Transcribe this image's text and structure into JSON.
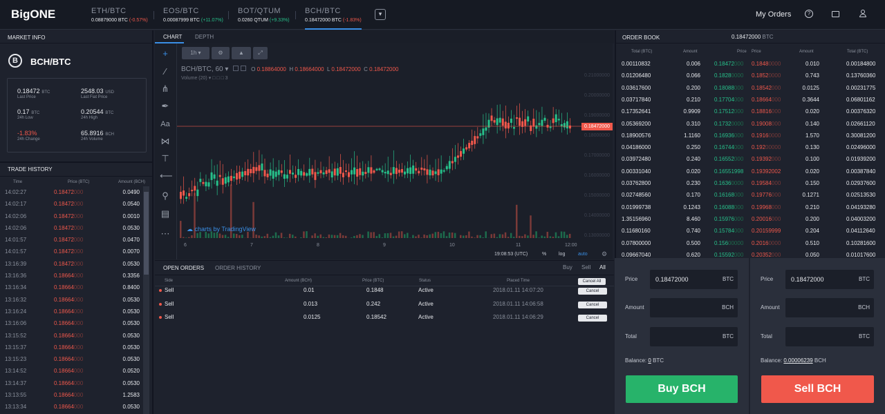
{
  "colors": {
    "bg": "#1e222d",
    "up": "#27c08a",
    "down": "#f0584b",
    "accent": "#3a8fe6"
  },
  "header": {
    "logo": "BigONE",
    "my_orders": "My Orders",
    "markets": [
      {
        "name": "ETH/BTC",
        "price": "0.08879000 BTC",
        "chg": "(-0.57%)",
        "dir": "dn"
      },
      {
        "name": "EOS/BTC",
        "price": "0.00087999 BTC",
        "chg": "(+11.07%)",
        "dir": "up"
      },
      {
        "name": "BOT/QTUM",
        "price": "0.0260 QTUM",
        "chg": "(+9.33%)",
        "dir": "up"
      },
      {
        "name": "BCH/BTC",
        "price": "0.18472000 BTC",
        "chg": "(-1.83%)",
        "dir": "dn"
      }
    ]
  },
  "market_info": {
    "title": "MARKET INFO",
    "pair": "BCH/BTC",
    "last_price": "0.18472",
    "last_price_unit": "BTC",
    "last_price_label": "Last Price",
    "last_fiat": "2548.03",
    "last_fiat_unit": "USD",
    "last_fiat_label": "Last Fiat Price",
    "low": "0.17",
    "low_unit": "BTC",
    "low_label": "24h Low",
    "high": "0.20544",
    "high_unit": "BTC",
    "high_label": "24h High",
    "change": "-1.83%",
    "change_label": "24h Change",
    "volume": "65.8916",
    "volume_unit": "BCH",
    "volume_label": "24h Volume"
  },
  "trade_history": {
    "title": "TRADE HISTORY",
    "col_time": "Time",
    "col_price": "Price (BTC)",
    "col_amount": "Amount (BCH)",
    "rows": [
      [
        "14:02:27",
        "0.18472000",
        "0.0490",
        "dn"
      ],
      [
        "14:02:17",
        "0.18472000",
        "0.0540",
        "dn"
      ],
      [
        "14:02:06",
        "0.18472000",
        "0.0010",
        "dn"
      ],
      [
        "14:02:06",
        "0.18472000",
        "0.0530",
        "dn"
      ],
      [
        "14:01:57",
        "0.18472000",
        "0.0470",
        "dn"
      ],
      [
        "14:01:57",
        "0.18472000",
        "0.0070",
        "dn"
      ],
      [
        "13:16:39",
        "0.18472000",
        "0.0530",
        "dn"
      ],
      [
        "13:16:36",
        "0.18664000",
        "0.3356",
        "dn"
      ],
      [
        "13:16:34",
        "0.18664000",
        "0.8400",
        "dn"
      ],
      [
        "13:16:32",
        "0.18664000",
        "0.0530",
        "dn"
      ],
      [
        "13:16:24",
        "0.18664000",
        "0.0530",
        "dn"
      ],
      [
        "13:16:06",
        "0.18664000",
        "0.0530",
        "dn"
      ],
      [
        "13:15:52",
        "0.18664000",
        "0.0530",
        "dn"
      ],
      [
        "13:15:37",
        "0.18664000",
        "0.0530",
        "dn"
      ],
      [
        "13:15:23",
        "0.18664000",
        "0.0530",
        "dn"
      ],
      [
        "13:14:52",
        "0.18664000",
        "0.0520",
        "dn"
      ],
      [
        "13:14:37",
        "0.18664000",
        "0.0530",
        "dn"
      ],
      [
        "13:13:55",
        "0.18664000",
        "1.2583",
        "dn"
      ],
      [
        "13:13:34",
        "0.18664000",
        "0.0530",
        "dn"
      ]
    ]
  },
  "chart": {
    "tab_chart": "CHART",
    "tab_depth": "DEPTH",
    "interval": "1h",
    "symbol": "BCH/BTC, 60",
    "o": "0.18864000",
    "h": "0.18664000",
    "l": "0.18472000",
    "c": "0.18472000",
    "volume_label": "Volume (20)",
    "volume_val": "3",
    "last_tag": "0.18472000",
    "brand": "charts by TradingView",
    "time": "19:08:53 (UTC)",
    "pct": "%",
    "log": "log",
    "auto": "auto",
    "y_ticks": [
      "0.21000000",
      "0.20000000",
      "0.19000000",
      "0.18000000",
      "0.17000000",
      "0.16000000",
      "0.15000000",
      "0.14000000",
      "0.13000000"
    ],
    "x_ticks": [
      "6",
      "7",
      "8",
      "9",
      "10",
      "11",
      "12:00"
    ]
  },
  "orders": {
    "tab_open": "OPEN ORDERS",
    "tab_history": "ORDER HISTORY",
    "f_buy": "Buy",
    "f_sell": "Sell",
    "f_all": "All",
    "col_side": "Side",
    "col_amount": "Amount (BCH)",
    "col_price": "Price (BTC)",
    "col_status": "Status",
    "col_placed": "Placed Time",
    "cancel_all": "Cancel All",
    "cancel": "Cancel",
    "rows": [
      {
        "side": "Sell",
        "amount": "0.01",
        "price": "0.1848",
        "status": "Active",
        "time": "2018.01.11 14:07:20"
      },
      {
        "side": "Sell",
        "amount": "0.013",
        "price": "0.242",
        "status": "Active",
        "time": "2018.01.11 14:06:58"
      },
      {
        "side": "Sell",
        "amount": "0.0125",
        "price": "0.18542",
        "status": "Active",
        "time": "2018.01.11 14:06:29"
      }
    ]
  },
  "order_book": {
    "title": "ORDER BOOK",
    "mid": "0.18472000",
    "mid_unit": "BTC",
    "col_total": "Total (BTC)",
    "col_amount": "Amount",
    "col_price": "Price",
    "rows": [
      [
        "0.00110832",
        "0.006",
        "0.18472000",
        "0.18480000",
        "0.010",
        "0.00184800"
      ],
      [
        "0.01206480",
        "0.066",
        "0.18280000",
        "0.18520000",
        "0.743",
        "0.13760360"
      ],
      [
        "0.03617600",
        "0.200",
        "0.18088000",
        "0.18542000",
        "0.0125",
        "0.00231775"
      ],
      [
        "0.03717840",
        "0.210",
        "0.17704000",
        "0.18664000",
        "0.3644",
        "0.06801162"
      ],
      [
        "0.17352641",
        "0.9909",
        "0.17512000",
        "0.18816000",
        "0.020",
        "0.00376320"
      ],
      [
        "0.05369200",
        "0.310",
        "0.17320000",
        "0.19008000",
        "0.140",
        "0.02661120"
      ],
      [
        "0.18900576",
        "1.1160",
        "0.16936000",
        "0.19160000",
        "1.570",
        "0.30081200"
      ],
      [
        "0.04186000",
        "0.250",
        "0.16744000",
        "0.19200000",
        "0.130",
        "0.02496000"
      ],
      [
        "0.03972480",
        "0.240",
        "0.16552000",
        "0.19392000",
        "0.100",
        "0.01939200"
      ],
      [
        "0.00331040",
        "0.020",
        "0.16551998",
        "0.19392002",
        "0.020",
        "0.00387840"
      ],
      [
        "0.03762800",
        "0.230",
        "0.16360000",
        "0.19584000",
        "0.150",
        "0.02937600"
      ],
      [
        "0.02748560",
        "0.170",
        "0.16168000",
        "0.19776000",
        "0.1271",
        "0.02513530"
      ],
      [
        "0.01999738",
        "0.1243",
        "0.16088000",
        "0.19968000",
        "0.210",
        "0.04193280"
      ],
      [
        "1.35156960",
        "8.460",
        "0.15976000",
        "0.20016000",
        "0.200",
        "0.04003200"
      ],
      [
        "0.11680160",
        "0.740",
        "0.15784000",
        "0.20159999",
        "0.204",
        "0.04112640"
      ],
      [
        "0.07800000",
        "0.500",
        "0.15600000",
        "0.20160000",
        "0.510",
        "0.10281600"
      ],
      [
        "0.09667040",
        "0.620",
        "0.15592000",
        "0.20352000",
        "0.050",
        "0.01017600"
      ]
    ]
  },
  "buy_form": {
    "price_label": "Price",
    "price": "0.18472000",
    "price_unit": "BTC",
    "amount_label": "Amount",
    "amount_unit": "BCH",
    "total_label": "Total",
    "total_unit": "BTC",
    "balance_label": "Balance:",
    "balance": "0",
    "balance_unit": "BTC",
    "button": "Buy BCH"
  },
  "sell_form": {
    "price_label": "Price",
    "price": "0.18472000",
    "price_unit": "BTC",
    "amount_label": "Amount",
    "amount_unit": "BCH",
    "total_label": "Total",
    "total_unit": "BTC",
    "balance_label": "Balance:",
    "balance": "0.00006239",
    "balance_unit": "BCH",
    "button": "Sell BCH"
  }
}
